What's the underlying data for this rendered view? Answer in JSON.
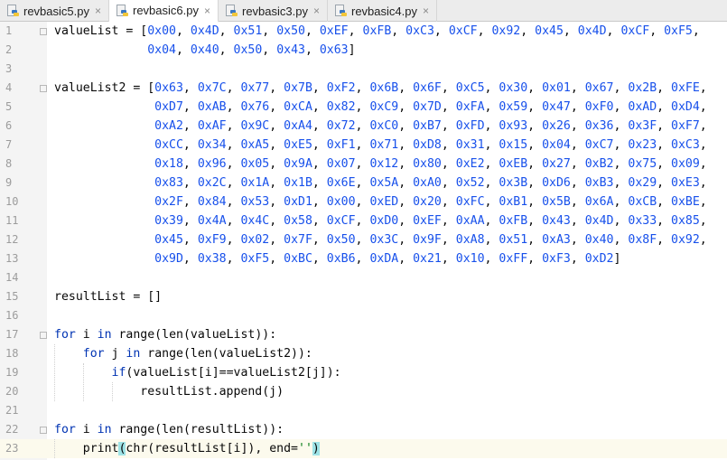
{
  "tabs": [
    {
      "label": "revbasic5.py",
      "active": false
    },
    {
      "label": "revbasic6.py",
      "active": true
    },
    {
      "label": "revbasic3.py",
      "active": false
    },
    {
      "label": "revbasic4.py",
      "active": false
    }
  ],
  "close_glyph": "×",
  "current_line": 23,
  "lines": [
    {
      "n": "1",
      "text": "valueList = [0x00, 0x4D, 0x51, 0x50, 0xEF, 0xFB, 0xC3, 0xCF, 0x92, 0x45, 0x4D, 0xCF, 0xF5,"
    },
    {
      "n": "2",
      "text": "             0x04, 0x40, 0x50, 0x43, 0x63]"
    },
    {
      "n": "3",
      "text": ""
    },
    {
      "n": "4",
      "text": "valueList2 = [0x63, 0x7C, 0x77, 0x7B, 0xF2, 0x6B, 0x6F, 0xC5, 0x30, 0x01, 0x67, 0x2B, 0xFE,"
    },
    {
      "n": "5",
      "text": "              0xD7, 0xAB, 0x76, 0xCA, 0x82, 0xC9, 0x7D, 0xFA, 0x59, 0x47, 0xF0, 0xAD, 0xD4,"
    },
    {
      "n": "6",
      "text": "              0xA2, 0xAF, 0x9C, 0xA4, 0x72, 0xC0, 0xB7, 0xFD, 0x93, 0x26, 0x36, 0x3F, 0xF7,"
    },
    {
      "n": "7",
      "text": "              0xCC, 0x34, 0xA5, 0xE5, 0xF1, 0x71, 0xD8, 0x31, 0x15, 0x04, 0xC7, 0x23, 0xC3,"
    },
    {
      "n": "8",
      "text": "              0x18, 0x96, 0x05, 0x9A, 0x07, 0x12, 0x80, 0xE2, 0xEB, 0x27, 0xB2, 0x75, 0x09,"
    },
    {
      "n": "9",
      "text": "              0x83, 0x2C, 0x1A, 0x1B, 0x6E, 0x5A, 0xA0, 0x52, 0x3B, 0xD6, 0xB3, 0x29, 0xE3,"
    },
    {
      "n": "10",
      "text": "              0x2F, 0x84, 0x53, 0xD1, 0x00, 0xED, 0x20, 0xFC, 0xB1, 0x5B, 0x6A, 0xCB, 0xBE,"
    },
    {
      "n": "11",
      "text": "              0x39, 0x4A, 0x4C, 0x58, 0xCF, 0xD0, 0xEF, 0xAA, 0xFB, 0x43, 0x4D, 0x33, 0x85,"
    },
    {
      "n": "12",
      "text": "              0x45, 0xF9, 0x02, 0x7F, 0x50, 0x3C, 0x9F, 0xA8, 0x51, 0xA3, 0x40, 0x8F, 0x92,"
    },
    {
      "n": "13",
      "text": "              0x9D, 0x38, 0xF5, 0xBC, 0xB6, 0xDA, 0x21, 0x10, 0xFF, 0xF3, 0xD2]"
    },
    {
      "n": "14",
      "text": ""
    },
    {
      "n": "15",
      "text": "resultList = []"
    },
    {
      "n": "16",
      "text": ""
    },
    {
      "n": "17",
      "text": "for i in range(len(valueList)):"
    },
    {
      "n": "18",
      "text": "    for j in range(len(valueList2)):"
    },
    {
      "n": "19",
      "text": "        if(valueList[i]==valueList2[j]):"
    },
    {
      "n": "20",
      "text": "            resultList.append(j)"
    },
    {
      "n": "21",
      "text": ""
    },
    {
      "n": "22",
      "text": "for i in range(len(resultList)):"
    },
    {
      "n": "23",
      "text": "    print(chr(resultList[i]), end='')"
    }
  ],
  "colors": {
    "keyword": "#0033b3",
    "number": "#1750eb",
    "string": "#067d17",
    "bracket_match": "#9ee3e6",
    "current_line": "#fcfaed"
  }
}
